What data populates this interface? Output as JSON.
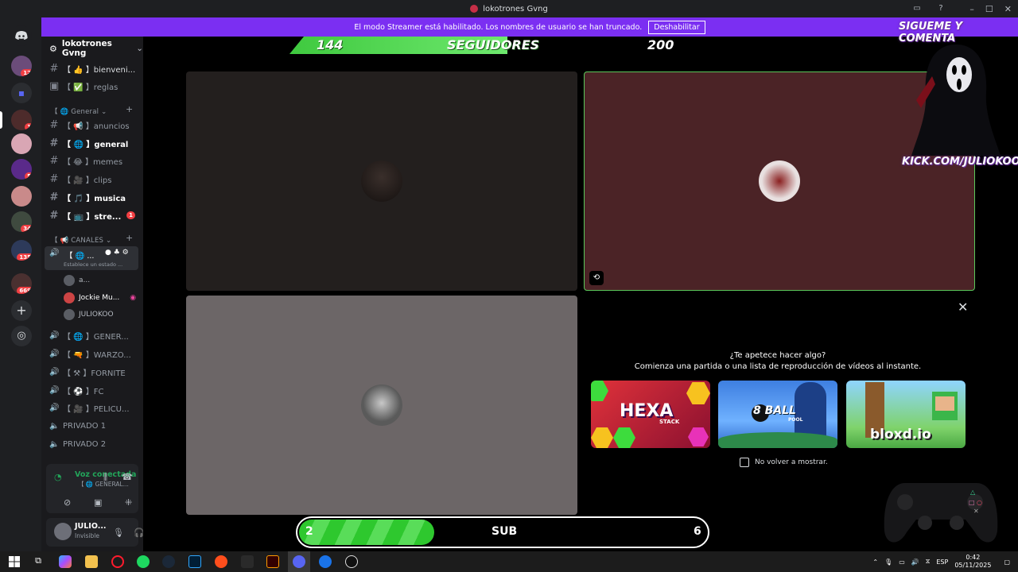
{
  "window": {
    "title": "lokotrones Gvng",
    "controls": [
      "–",
      "☐",
      "✕"
    ]
  },
  "banner": {
    "message": "El modo Streamer está habilitado. Los nombres de usuario se han truncado.",
    "button": "Deshabilitar"
  },
  "rail": {
    "badges": [
      "12",
      "1",
      "5",
      "34",
      "135",
      "669"
    ]
  },
  "server": {
    "name": "lokotrones Gvng"
  },
  "channels": {
    "top": [
      {
        "label": "【 👍 】bienveni...",
        "color": "#f0b232"
      },
      {
        "label": "【 ✅ 】reglas",
        "color": "#23a55a"
      }
    ],
    "cat_general": "【 🌐 General ⌄",
    "general": [
      {
        "label": "【 📢 】anuncios",
        "color": "#f23f43",
        "active": false
      },
      {
        "label": "【 🌐 】general",
        "color": "#23a55a",
        "active": true
      },
      {
        "label": "【 😂 】memes",
        "color": "#f0b232",
        "active": false
      },
      {
        "label": "【 🎥 】clips",
        "color": "#949ba4",
        "active": false
      },
      {
        "label": "【 🎵 】musica",
        "color": "#5865f2",
        "active": true
      },
      {
        "label": "【 📺 】stre...",
        "color": "#949ba4",
        "active": true,
        "badge": "1"
      }
    ],
    "cat_canales": "【 📢 CANALES ⌄",
    "voice_active": {
      "label": "【 🌐 ...",
      "status": "Establece un estado ..."
    },
    "voice_users": [
      {
        "name": "a..."
      },
      {
        "name": "Jockie Mu..."
      },
      {
        "name": "JULIOKOO"
      }
    ],
    "voice_others": [
      {
        "label": "【 🌐 】GENER..."
      },
      {
        "label": "【 🔫 】WARZO..."
      },
      {
        "label": "【 ⚒ 】FORNITE"
      },
      {
        "label": "【 ⚽ 】FC"
      },
      {
        "label": "【 🎥 】PELICU..."
      },
      {
        "label": "PRIVADO 1"
      },
      {
        "label": "PRIVADO 2"
      }
    ]
  },
  "voice_panel": {
    "status": "Voz conectada",
    "channel": "【 🌐 GENERAL..."
  },
  "user_panel": {
    "name": "JULIO...",
    "status": "Invisible"
  },
  "overlay": {
    "followers_current": "144",
    "followers_label": "SEGUIDORES",
    "followers_goal": "200",
    "followers_progress": 0.72,
    "sub_current": "2",
    "sub_label": "SUB",
    "sub_goal": "6",
    "sub_progress": 0.33,
    "kick_top": "SIGUEME Y COMENTA",
    "kick_url": "KICK.COM/JULIOKOO"
  },
  "activity": {
    "title": "¿Te apetece hacer algo?",
    "subtitle": "Comienza una partida o una lista de reproducción de vídeos al instante.",
    "games": [
      {
        "name": "HEXA",
        "sub": "STACK"
      },
      {
        "name": "8 BALL",
        "sub": "POOL"
      },
      {
        "name": "bloxd.io",
        "sub": ""
      }
    ],
    "dont_show": "No volver a mostrar."
  },
  "taskbar": {
    "lang": "ESP",
    "time": "0:42",
    "date": "05/11/2025"
  },
  "colors": {
    "discord_bg": "#1e1f22",
    "banner": "#7b2ff2",
    "green": "#23a55a",
    "overlay_green": "#3fc93f"
  }
}
